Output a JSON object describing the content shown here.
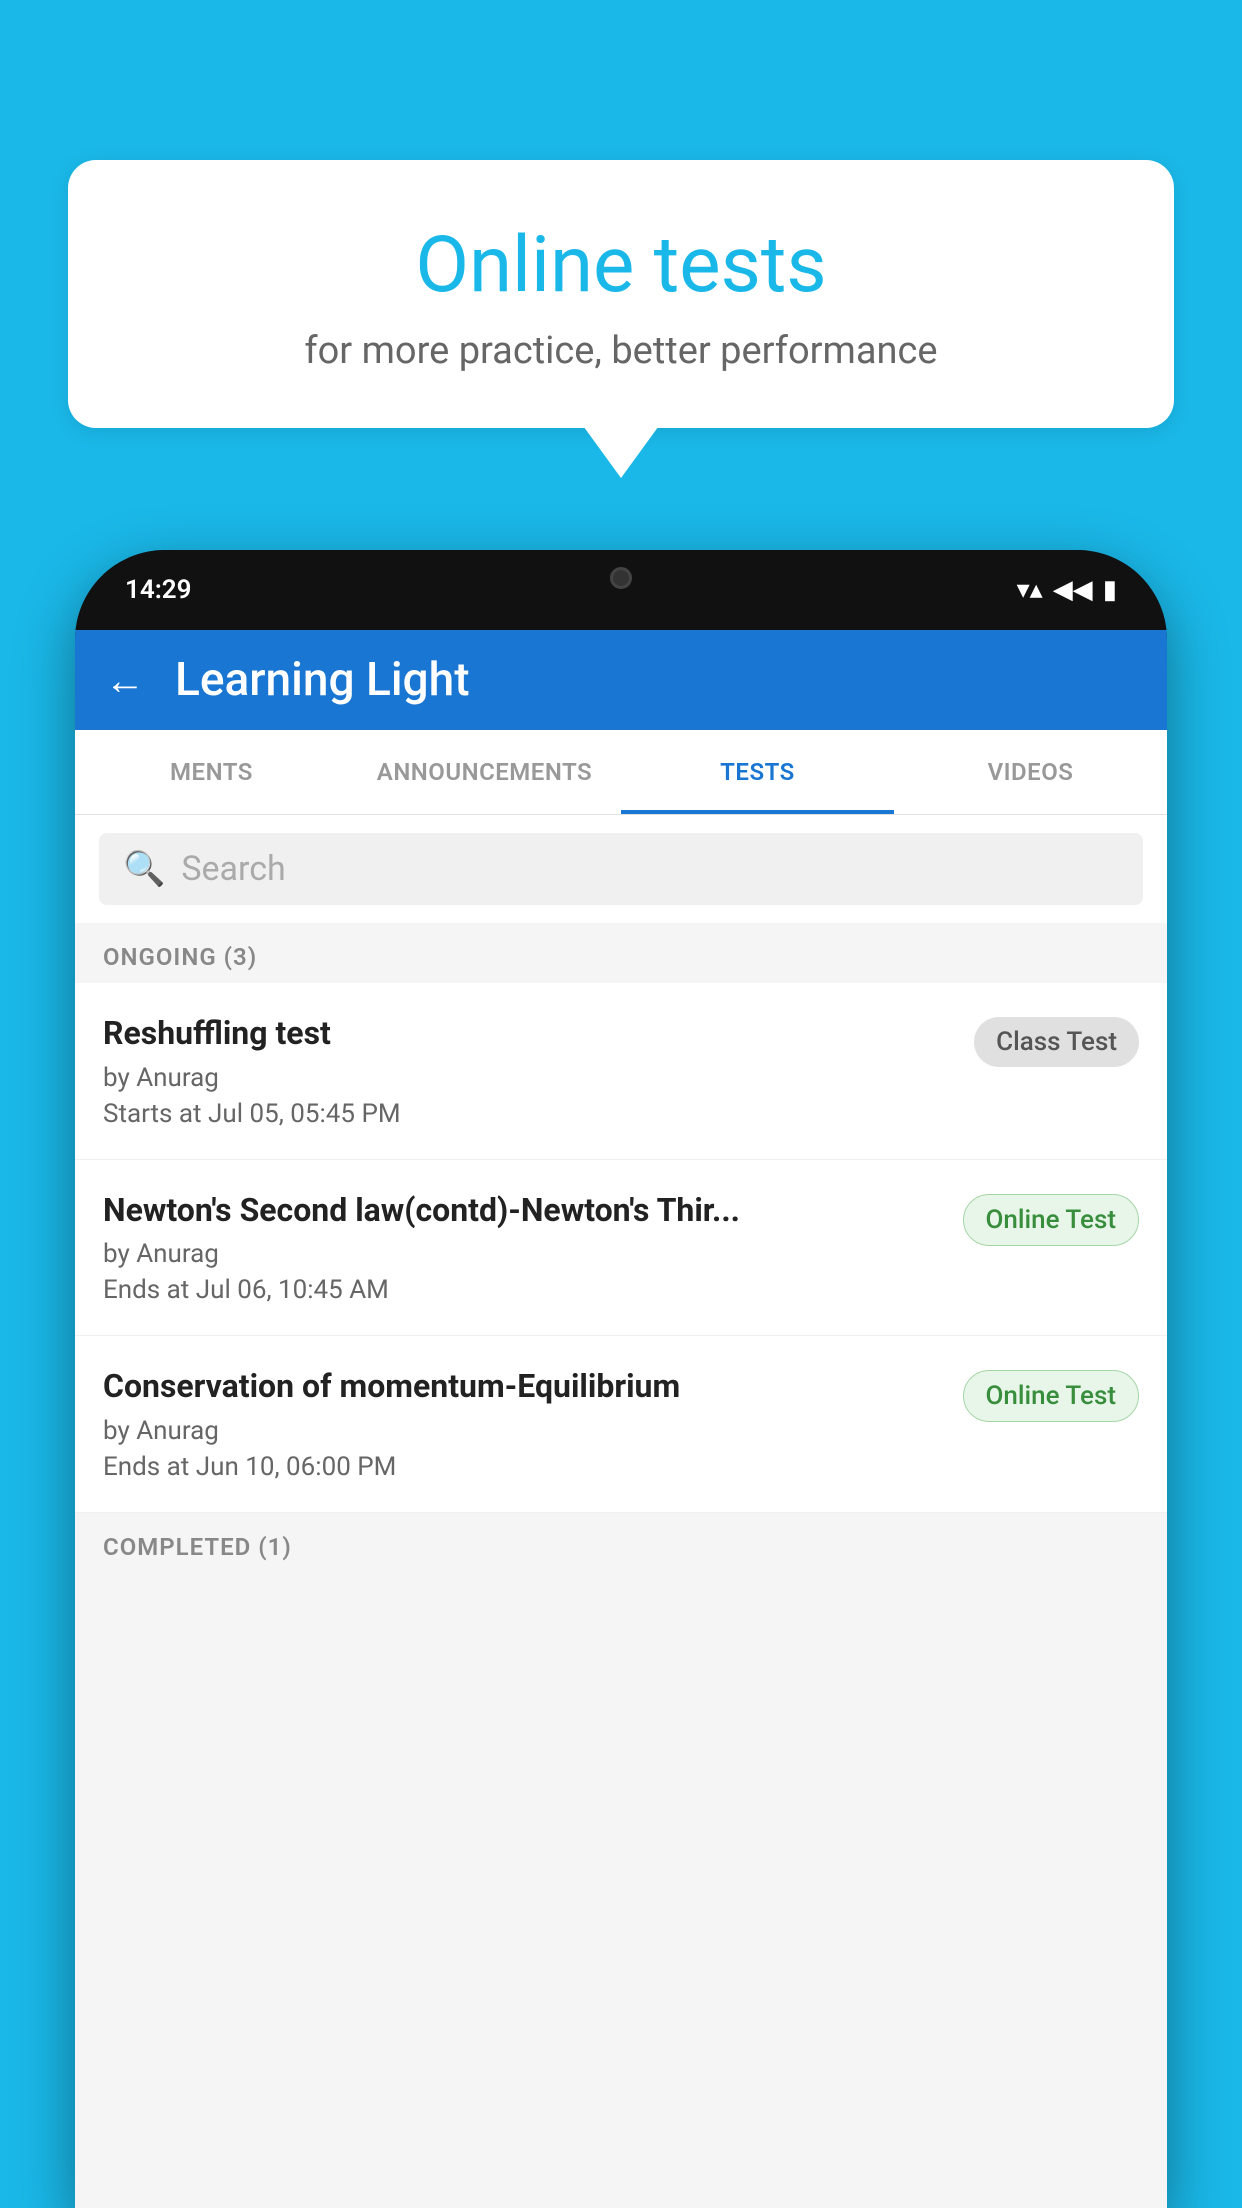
{
  "background": {
    "color": "#1ab8e8"
  },
  "speech_bubble": {
    "title": "Online tests",
    "subtitle": "for more practice, better performance"
  },
  "phone": {
    "status_bar": {
      "time": "14:29",
      "wifi_icon": "▼",
      "signal_icon": "▲",
      "battery_icon": "▮"
    },
    "app_bar": {
      "back_label": "←",
      "title": "Learning Light"
    },
    "tabs": [
      {
        "label": "MENTS",
        "active": false
      },
      {
        "label": "ANNOUNCEMENTS",
        "active": false
      },
      {
        "label": "TESTS",
        "active": true
      },
      {
        "label": "VIDEOS",
        "active": false
      }
    ],
    "search": {
      "placeholder": "Search"
    },
    "ongoing_section": {
      "label": "ONGOING (3)"
    },
    "tests": [
      {
        "name": "Reshuffling test",
        "author": "by Anurag",
        "time_label": "Starts at",
        "time": "Jul 05, 05:45 PM",
        "badge": "Class Test",
        "badge_type": "class"
      },
      {
        "name": "Newton's Second law(contd)-Newton's Thir...",
        "author": "by Anurag",
        "time_label": "Ends at",
        "time": "Jul 06, 10:45 AM",
        "badge": "Online Test",
        "badge_type": "online"
      },
      {
        "name": "Conservation of momentum-Equilibrium",
        "author": "by Anurag",
        "time_label": "Ends at",
        "time": "Jun 10, 06:00 PM",
        "badge": "Online Test",
        "badge_type": "online"
      }
    ],
    "completed_section": {
      "label": "COMPLETED (1)"
    }
  }
}
